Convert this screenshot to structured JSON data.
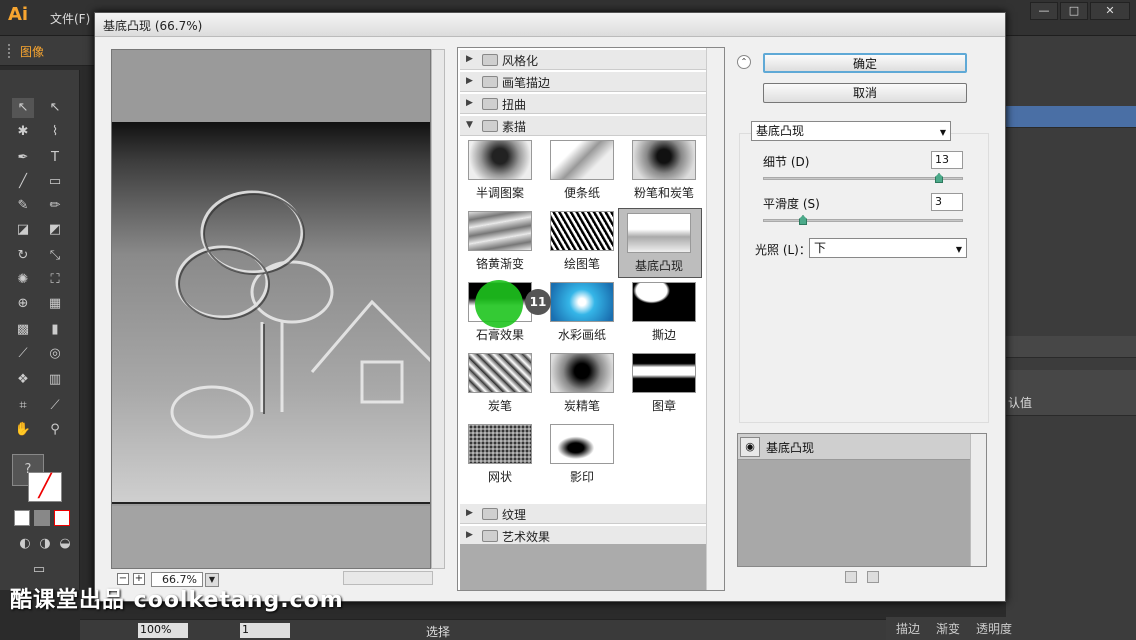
{
  "app": {
    "logo": "Ai",
    "menu_file": "文件(F)",
    "control_label": "图像",
    "window_buttons": [
      "—",
      "□",
      "✕"
    ]
  },
  "dialog": {
    "title": "基底凸现 (66.7%)",
    "zoom": "66.7%",
    "zoom_minus": "−",
    "zoom_plus": "+",
    "ok": "确定",
    "cancel": "取消",
    "selected_filter": "基底凸现",
    "detail_label": "细节 (D)",
    "detail_value": "13",
    "detail_level": 0.88,
    "smooth_label": "平滑度 (S)",
    "smooth_value": "3",
    "smooth_level": 0.2,
    "light_label": "光照 (L)：",
    "light_value": "下",
    "layer_name": "基底凸现"
  },
  "tree": {
    "folders_top": [
      "风格化",
      "画笔描边",
      "扭曲"
    ],
    "open_folder": "素描",
    "thumbnails": [
      {
        "label": "半调图案"
      },
      {
        "label": "便条纸"
      },
      {
        "label": "粉笔和炭笔"
      },
      {
        "label": "铬黄渐变"
      },
      {
        "label": "绘图笔"
      },
      {
        "label": "基底凸现"
      },
      {
        "label": "石膏效果"
      },
      {
        "label": "水彩画纸"
      },
      {
        "label": "撕边"
      },
      {
        "label": "炭笔"
      },
      {
        "label": "炭精笔"
      },
      {
        "label": "图章"
      },
      {
        "label": "网状"
      },
      {
        "label": "影印"
      }
    ],
    "folders_bottom": [
      "纹理",
      "艺术效果"
    ]
  },
  "right_panel": {
    "value_label": "认值"
  },
  "status": {
    "zoom": "100%",
    "page": "1",
    "tool": "选择"
  },
  "bottom_tabs": [
    "描边",
    "渐变",
    "透明度"
  ],
  "watermark": "酷课堂出品 coolketang.com",
  "step_number": "11"
}
